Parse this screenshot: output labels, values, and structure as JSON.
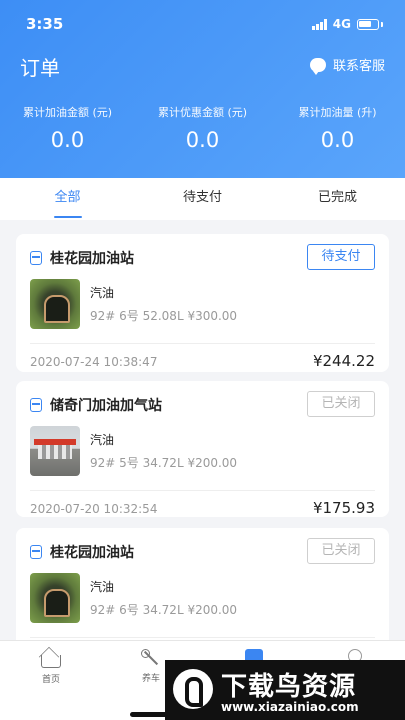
{
  "statusbar": {
    "time": "3:35",
    "network": "4G"
  },
  "header": {
    "title": "订单",
    "service_label": "联系客服",
    "stats": [
      {
        "label": "累计加油金额 (元)",
        "value": "0.0"
      },
      {
        "label": "累计优惠金额 (元)",
        "value": "0.0"
      },
      {
        "label": "累计加油量 (升)",
        "value": "0.0"
      }
    ]
  },
  "tabs": [
    {
      "label": "全部",
      "active": true
    },
    {
      "label": "待支付",
      "active": false
    },
    {
      "label": "已完成",
      "active": false
    }
  ],
  "orders": [
    {
      "station": "桂花园加油站",
      "status": "待支付",
      "fuel": "汽油",
      "detail": "92#  6号  52.08L  ¥300.00",
      "time": "2020-07-24 10:38:47",
      "amount": "¥244.22"
    },
    {
      "station": "储奇门加油加气站",
      "status": "已关闭",
      "fuel": "汽油",
      "detail": "92#  5号  34.72L  ¥200.00",
      "time": "2020-07-20 10:32:54",
      "amount": "¥175.93"
    },
    {
      "station": "桂花园加油站",
      "status": "已关闭",
      "fuel": "汽油",
      "detail": "92#  6号  34.72L  ¥200.00",
      "time": "",
      "amount": ""
    }
  ],
  "bottom_nav": [
    {
      "label": "首页",
      "icon": "home-icon"
    },
    {
      "label": "养车",
      "icon": "wrench-icon"
    },
    {
      "label": "",
      "icon": "orders-icon"
    },
    {
      "label": "",
      "icon": "profile-icon"
    }
  ],
  "watermark": {
    "title": "下载鸟资源",
    "url": "www.xiazainiao.com"
  },
  "colors": {
    "primary": "#3b86f2",
    "header_gradient_start": "#3d8ef5",
    "header_gradient_end": "#5aa5fb"
  }
}
